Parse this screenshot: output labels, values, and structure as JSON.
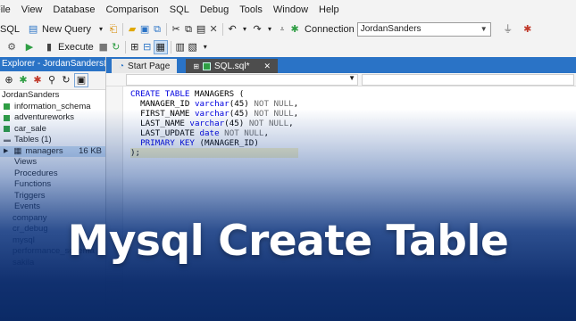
{
  "menu": [
    "File",
    "View",
    "Database",
    "Comparison",
    "SQL",
    "Debug",
    "Tools",
    "Window",
    "Help"
  ],
  "toolbar1": {
    "sql_label": "SQL",
    "new_query_label": "New Query",
    "connection_label": "Connection",
    "connection_value": "JordanSanders"
  },
  "toolbar2": {
    "execute_label": "Execute"
  },
  "explorer": {
    "title": "Explorer - JordanSanders",
    "tree": [
      {
        "label": "JordanSanders",
        "kind": "root"
      },
      {
        "label": "information_schema",
        "kind": "db"
      },
      {
        "label": "adventureworks",
        "kind": "db"
      },
      {
        "label": "car_sale",
        "kind": "db"
      },
      {
        "label": "Tables (1)",
        "kind": "folder"
      },
      {
        "label": "managers",
        "kind": "table",
        "size": "16 KB"
      },
      {
        "label": "Views",
        "kind": "folder"
      },
      {
        "label": "Procedures",
        "kind": "folder"
      },
      {
        "label": "Functions",
        "kind": "folder"
      },
      {
        "label": "Triggers",
        "kind": "folder"
      },
      {
        "label": "Events",
        "kind": "folder"
      },
      {
        "label": "company",
        "kind": "db"
      },
      {
        "label": "cr_debug",
        "kind": "db"
      },
      {
        "label": "mysql",
        "kind": "db"
      },
      {
        "label": "performance_schema",
        "kind": "db"
      },
      {
        "label": "sakila",
        "kind": "db"
      }
    ]
  },
  "tabs": {
    "start_page": "Start Page",
    "sql_tab": "SQL.sql*"
  },
  "code": {
    "l1_kw": "CREATE TABLE",
    "l1_txt": " MANAGERS (",
    "l2_txt": "MANAGER_ID",
    "l2_kw": "varchar",
    "l2_rest": "(45)",
    "l2_nul": "NOT NULL",
    "l3_txt": "FIRST_NAME",
    "l3_kw": "varchar",
    "l3_rest": "(45)",
    "l3_nul": "NOT NULL",
    "l4_txt": "LAST_NAME",
    "l4_kw": "varchar",
    "l4_rest": "(45)",
    "l4_nul": "NOT NULL",
    "l5_txt": "LAST_UPDATE",
    "l5_kw": "date",
    "l5_nul": "NOT NULL",
    "l6_kw": "PRIMARY KEY",
    "l6_rest": " (MANAGER_ID)",
    "l7_txt": ");"
  },
  "headline": "Mysql Create Table",
  "colors": {
    "accent": "#2a73c6",
    "keyword": "#0000e0",
    "overlay_dark": "#0b2a66"
  }
}
